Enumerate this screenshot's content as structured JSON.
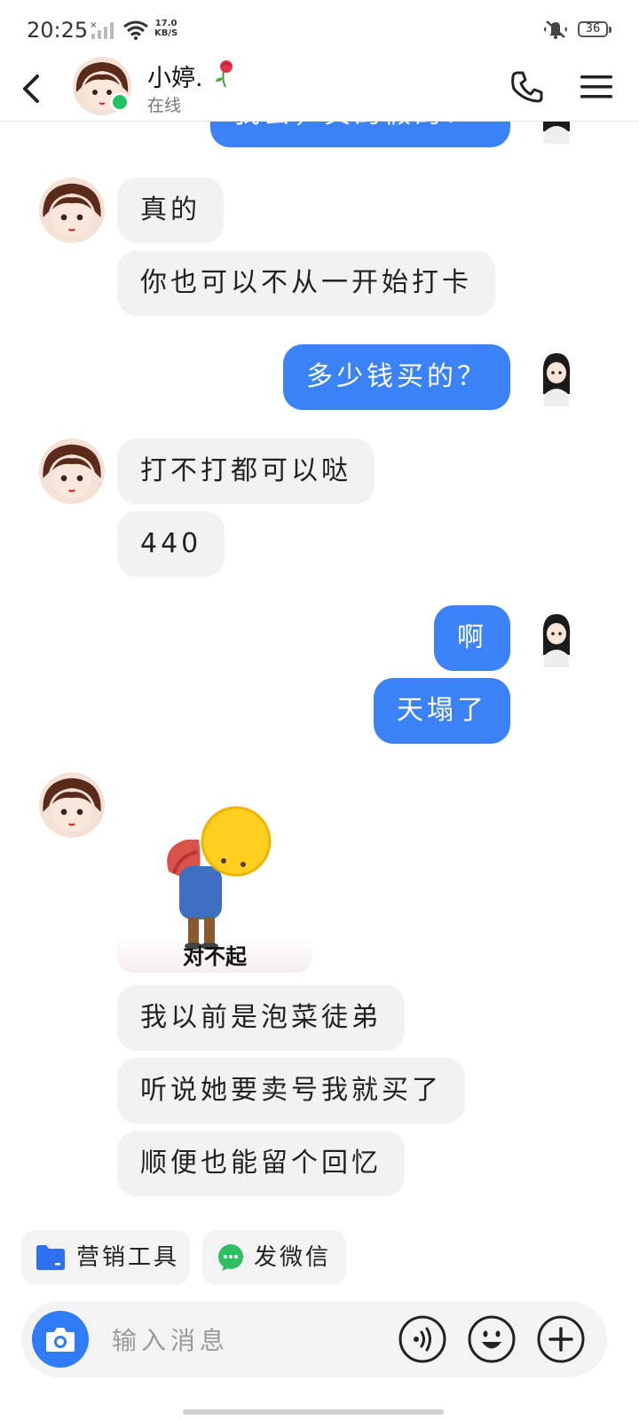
{
  "status_bar": {
    "time": "20:25",
    "speed_value": "17.0",
    "speed_unit": "KB/S",
    "battery": "36"
  },
  "header": {
    "contact_name": "小婷.",
    "status": "在线"
  },
  "messages": [
    {
      "side": "out",
      "text": "我去，真的假的？"
    },
    {
      "side": "in",
      "text": "真的"
    },
    {
      "side": "in",
      "text": "你也可以不从一开始打卡"
    },
    {
      "side": "out",
      "text": "多少钱买的？"
    },
    {
      "side": "in",
      "text": "打不打都可以哒"
    },
    {
      "side": "in",
      "text": "440"
    },
    {
      "side": "out",
      "text": "啊"
    },
    {
      "side": "out",
      "text": "天塌了"
    },
    {
      "side": "in",
      "type": "sticker",
      "text": "对不起"
    },
    {
      "side": "in",
      "text": "我以前是泡菜徒弟"
    },
    {
      "side": "in",
      "text": "听说她要卖号我就买了"
    },
    {
      "side": "in",
      "text": "顺便也能留个回忆"
    }
  ],
  "quick_actions": [
    {
      "label": "营销工具",
      "icon": "folder-icon"
    },
    {
      "label": "发微信",
      "icon": "wechat-icon"
    }
  ],
  "input": {
    "placeholder": "输入消息"
  },
  "colors": {
    "accent": "#3b82f6",
    "incoming_bubble": "#f2f2f3",
    "online": "#22c35e"
  }
}
